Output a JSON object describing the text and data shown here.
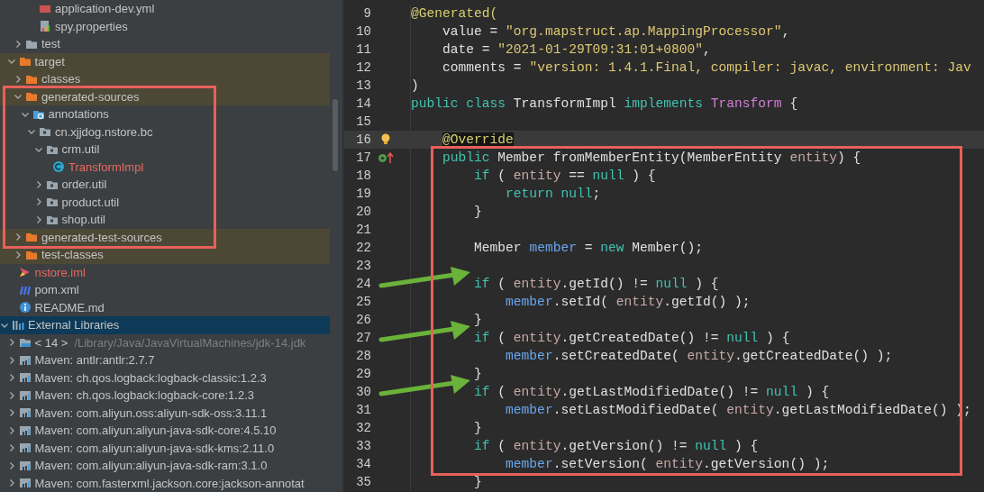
{
  "project_tree": {
    "items": [
      {
        "children": [
          {
            "children": [
              {
                "children": [
                  {
                    "children": [
                      {
                        "label": "application-dev.yml",
                        "kind": "yml-file",
                        "selected": false,
                        "excluded": false,
                        "untracked": false,
                        "in_callout": false
                      },
                      {
                        "label": "spy.properties",
                        "kind": "properties-file",
                        "selected": false,
                        "excluded": false,
                        "untracked": false,
                        "in_callout": false
                      }
                    ]
                  }
                ]
              },
              {
                "label": "test",
                "kind": "folder",
                "expanded": false,
                "selected": false,
                "excluded": false,
                "untracked": false,
                "in_callout": false
              }
            ]
          },
          {
            "label": "target",
            "kind": "folder",
            "expanded": true,
            "selected": false,
            "excluded": true,
            "untracked": false,
            "in_callout": false,
            "children": [
              {
                "label": "classes",
                "kind": "folder",
                "expanded": false,
                "selected": false,
                "excluded": true,
                "untracked": false,
                "in_callout": false
              },
              {
                "label": "generated-sources",
                "kind": "folder",
                "expanded": true,
                "selected": false,
                "excluded": true,
                "untracked": false,
                "in_callout": true,
                "children": [
                  {
                    "label": "annotations",
                    "kind": "source-root",
                    "expanded": true,
                    "selected": false,
                    "excluded": false,
                    "untracked": false,
                    "in_callout": true,
                    "children": [
                      {
                        "label": "cn.xjjdog.nstore.bc",
                        "kind": "package",
                        "expanded": true,
                        "selected": false,
                        "excluded": false,
                        "untracked": false,
                        "in_callout": true,
                        "children": [
                          {
                            "label": "crm.util",
                            "kind": "package",
                            "expanded": true,
                            "selected": false,
                            "excluded": false,
                            "untracked": false,
                            "in_callout": true,
                            "children": [
                              {
                                "label": "TransformImpl",
                                "kind": "class",
                                "selected": false,
                                "excluded": false,
                                "untracked": true,
                                "in_callout": true
                              }
                            ]
                          },
                          {
                            "label": "order.util",
                            "kind": "package",
                            "expanded": false,
                            "selected": false,
                            "excluded": false,
                            "untracked": false,
                            "in_callout": true
                          },
                          {
                            "label": "product.util",
                            "kind": "package",
                            "expanded": false,
                            "selected": false,
                            "excluded": false,
                            "untracked": false,
                            "in_callout": true
                          },
                          {
                            "label": "shop.util",
                            "kind": "package",
                            "expanded": false,
                            "selected": false,
                            "excluded": false,
                            "untracked": false,
                            "in_callout": true
                          }
                        ]
                      }
                    ]
                  }
                ]
              },
              {
                "label": "generated-test-sources",
                "kind": "folder",
                "expanded": false,
                "selected": false,
                "excluded": true,
                "untracked": false,
                "in_callout": true
              },
              {
                "label": "test-classes",
                "kind": "folder",
                "expanded": false,
                "selected": false,
                "excluded": true,
                "untracked": false,
                "in_callout": false
              }
            ]
          },
          {
            "label": "nstore.iml",
            "kind": "module-file",
            "selected": false,
            "excluded": false,
            "untracked": true,
            "in_callout": false
          },
          {
            "label": "pom.xml",
            "kind": "maven-file",
            "selected": false,
            "excluded": false,
            "untracked": false,
            "in_callout": false
          },
          {
            "label": "README.md",
            "kind": "info-file",
            "selected": false,
            "excluded": false,
            "untracked": false,
            "in_callout": false
          }
        ]
      },
      {
        "label": "External Libraries",
        "kind": "libraries",
        "expanded": true,
        "selected": true,
        "excluded": false,
        "untracked": false,
        "in_callout": false,
        "children": [
          {
            "label": "< 14 >",
            "detail": "/Library/Java/JavaVirtualMachines/jdk-14.jdk",
            "kind": "jdk",
            "expanded": false,
            "selected": false,
            "excluded": false,
            "untracked": false,
            "in_callout": false
          },
          {
            "label": "Maven: antlr:antlr:2.7.7",
            "kind": "library",
            "expanded": false,
            "selected": false,
            "excluded": false,
            "untracked": false,
            "in_callout": false
          },
          {
            "label": "Maven: ch.qos.logback:logback-classic:1.2.3",
            "kind": "library",
            "expanded": false,
            "selected": false,
            "excluded": false,
            "untracked": false,
            "in_callout": false
          },
          {
            "label": "Maven: ch.qos.logback:logback-core:1.2.3",
            "kind": "library",
            "expanded": false,
            "selected": false,
            "excluded": false,
            "untracked": false,
            "in_callout": false
          },
          {
            "label": "Maven: com.aliyun.oss:aliyun-sdk-oss:3.11.1",
            "kind": "library",
            "expanded": false,
            "selected": false,
            "excluded": false,
            "untracked": false,
            "in_callout": false
          },
          {
            "label": "Maven: com.aliyun:aliyun-java-sdk-core:4.5.10",
            "kind": "library",
            "expanded": false,
            "selected": false,
            "excluded": false,
            "untracked": false,
            "in_callout": false
          },
          {
            "label": "Maven: com.aliyun:aliyun-java-sdk-kms:2.11.0",
            "kind": "library",
            "expanded": false,
            "selected": false,
            "excluded": false,
            "untracked": false,
            "in_callout": false
          },
          {
            "label": "Maven: com.aliyun:aliyun-java-sdk-ram:3.1.0",
            "kind": "library",
            "expanded": false,
            "selected": false,
            "excluded": false,
            "untracked": false,
            "in_callout": false
          },
          {
            "label": "Maven: com.fasterxml.jackson.core:jackson-annotat",
            "kind": "library",
            "expanded": false,
            "selected": false,
            "excluded": false,
            "untracked": false,
            "in_callout": false
          }
        ]
      }
    ]
  },
  "editor": {
    "lines": [
      {
        "number": "9",
        "current": false,
        "in_callout": false,
        "arrow": false,
        "tokens": [
          {
            "text": "@Generated(",
            "kind": "annotation"
          }
        ]
      },
      {
        "number": "10",
        "current": false,
        "in_callout": false,
        "arrow": false,
        "tokens": [
          {
            "text": "    value = ",
            "kind": "plain"
          },
          {
            "text": "\"org.mapstruct.ap.MappingProcessor\"",
            "kind": "string"
          },
          {
            "text": ",",
            "kind": "plain"
          }
        ]
      },
      {
        "number": "11",
        "current": false,
        "in_callout": false,
        "arrow": false,
        "tokens": [
          {
            "text": "    date = ",
            "kind": "plain"
          },
          {
            "text": "\"2021-01-29T09:31:01+0800\"",
            "kind": "string"
          },
          {
            "text": ",",
            "kind": "plain"
          }
        ]
      },
      {
        "number": "12",
        "current": false,
        "in_callout": false,
        "arrow": false,
        "tokens": [
          {
            "text": "    comments = ",
            "kind": "plain"
          },
          {
            "text": "\"version: 1.4.1.Final, compiler: javac, environment: Jav",
            "kind": "string"
          }
        ]
      },
      {
        "number": "13",
        "current": false,
        "in_callout": false,
        "arrow": false,
        "tokens": [
          {
            "text": ")",
            "kind": "plain"
          }
        ]
      },
      {
        "number": "14",
        "current": false,
        "in_callout": false,
        "arrow": false,
        "tokens": [
          {
            "text": "public class ",
            "kind": "keyword"
          },
          {
            "text": "TransformImpl ",
            "kind": "plain"
          },
          {
            "text": "implements ",
            "kind": "keyword"
          },
          {
            "text": "Transform",
            "kind": "interface"
          },
          {
            "text": " {",
            "kind": "plain"
          }
        ]
      },
      {
        "number": "15",
        "current": false,
        "in_callout": false,
        "arrow": false
      },
      {
        "number": "16",
        "kind": "bulb",
        "current": true,
        "in_callout": false,
        "arrow": false,
        "tokens": [
          {
            "text": "    @Override",
            "kind": "annotation-match"
          }
        ]
      },
      {
        "number": "17",
        "kind": "override",
        "current": false,
        "in_callout": true,
        "arrow": false,
        "tokens": [
          {
            "text": "    public ",
            "kind": "keyword"
          },
          {
            "text": "Member fromMemberEntity(MemberEntity ",
            "kind": "plain"
          },
          {
            "text": "entity",
            "kind": "parameter"
          },
          {
            "text": ") {",
            "kind": "plain"
          }
        ]
      },
      {
        "number": "18",
        "current": false,
        "in_callout": true,
        "arrow": false,
        "tokens": [
          {
            "text": "        if ",
            "kind": "keyword"
          },
          {
            "text": "( ",
            "kind": "plain"
          },
          {
            "text": "entity",
            "kind": "parameter"
          },
          {
            "text": " == ",
            "kind": "plain"
          },
          {
            "text": "null",
            "kind": "keyword"
          },
          {
            "text": " ) {",
            "kind": "plain"
          }
        ]
      },
      {
        "number": "19",
        "current": false,
        "in_callout": true,
        "arrow": false,
        "tokens": [
          {
            "text": "            return null",
            "kind": "keyword"
          },
          {
            "text": ";",
            "kind": "plain"
          }
        ]
      },
      {
        "number": "20",
        "current": false,
        "in_callout": true,
        "arrow": false,
        "tokens": [
          {
            "text": "        }",
            "kind": "plain"
          }
        ]
      },
      {
        "number": "21",
        "current": false,
        "in_callout": true,
        "arrow": false
      },
      {
        "number": "22",
        "current": false,
        "in_callout": true,
        "arrow": false,
        "tokens": [
          {
            "text": "        Member ",
            "kind": "plain"
          },
          {
            "text": "member",
            "kind": "local"
          },
          {
            "text": " = ",
            "kind": "plain"
          },
          {
            "text": "new ",
            "kind": "keyword"
          },
          {
            "text": "Member();",
            "kind": "plain"
          }
        ]
      },
      {
        "number": "23",
        "current": false,
        "in_callout": true,
        "arrow": false
      },
      {
        "number": "24",
        "current": false,
        "in_callout": true,
        "arrow": true,
        "tokens": [
          {
            "text": "        if ",
            "kind": "keyword"
          },
          {
            "text": "( ",
            "kind": "plain"
          },
          {
            "text": "entity",
            "kind": "parameter"
          },
          {
            "text": ".getId() != ",
            "kind": "plain"
          },
          {
            "text": "null",
            "kind": "keyword"
          },
          {
            "text": " ) {",
            "kind": "plain"
          }
        ]
      },
      {
        "number": "25",
        "current": false,
        "in_callout": true,
        "arrow": false,
        "tokens": [
          {
            "text": "            member",
            "kind": "local"
          },
          {
            "text": ".setId( ",
            "kind": "plain"
          },
          {
            "text": "entity",
            "kind": "parameter"
          },
          {
            "text": ".getId() );",
            "kind": "plain"
          }
        ]
      },
      {
        "number": "26",
        "current": false,
        "in_callout": true,
        "arrow": false,
        "tokens": [
          {
            "text": "        }",
            "kind": "plain"
          }
        ]
      },
      {
        "number": "27",
        "current": false,
        "in_callout": true,
        "arrow": true,
        "tokens": [
          {
            "text": "        if ",
            "kind": "keyword"
          },
          {
            "text": "( ",
            "kind": "plain"
          },
          {
            "text": "entity",
            "kind": "parameter"
          },
          {
            "text": ".getCreatedDate() != ",
            "kind": "plain"
          },
          {
            "text": "null",
            "kind": "keyword"
          },
          {
            "text": " ) {",
            "kind": "plain"
          }
        ]
      },
      {
        "number": "28",
        "current": false,
        "in_callout": true,
        "arrow": false,
        "tokens": [
          {
            "text": "            member",
            "kind": "local"
          },
          {
            "text": ".setCreatedDate( ",
            "kind": "plain"
          },
          {
            "text": "entity",
            "kind": "parameter"
          },
          {
            "text": ".getCreatedDate() );",
            "kind": "plain"
          }
        ]
      },
      {
        "number": "29",
        "current": false,
        "in_callout": true,
        "arrow": false,
        "tokens": [
          {
            "text": "        }",
            "kind": "plain"
          }
        ]
      },
      {
        "number": "30",
        "current": false,
        "in_callout": true,
        "arrow": true,
        "tokens": [
          {
            "text": "        if ",
            "kind": "keyword"
          },
          {
            "text": "( ",
            "kind": "plain"
          },
          {
            "text": "entity",
            "kind": "parameter"
          },
          {
            "text": ".getLastModifiedDate() != ",
            "kind": "plain"
          },
          {
            "text": "null",
            "kind": "keyword"
          },
          {
            "text": " ) {",
            "kind": "plain"
          }
        ]
      },
      {
        "number": "31",
        "current": false,
        "in_callout": true,
        "arrow": false,
        "tokens": [
          {
            "text": "            member",
            "kind": "local"
          },
          {
            "text": ".setLastModifiedDate( ",
            "kind": "plain"
          },
          {
            "text": "entity",
            "kind": "parameter"
          },
          {
            "text": ".getLastModifiedDate() );",
            "kind": "plain"
          }
        ]
      },
      {
        "number": "32",
        "current": false,
        "in_callout": true,
        "arrow": false,
        "tokens": [
          {
            "text": "        }",
            "kind": "plain"
          }
        ]
      },
      {
        "number": "33",
        "current": false,
        "in_callout": true,
        "arrow": false,
        "tokens": [
          {
            "text": "        if ",
            "kind": "keyword"
          },
          {
            "text": "( ",
            "kind": "plain"
          },
          {
            "text": "entity",
            "kind": "parameter"
          },
          {
            "text": ".getVersion() != ",
            "kind": "plain"
          },
          {
            "text": "null",
            "kind": "keyword"
          },
          {
            "text": " ) {",
            "kind": "plain"
          }
        ]
      },
      {
        "number": "34",
        "current": false,
        "in_callout": true,
        "arrow": false,
        "tokens": [
          {
            "text": "            member",
            "kind": "local"
          },
          {
            "text": ".setVersion( ",
            "kind": "plain"
          },
          {
            "text": "entity",
            "kind": "parameter"
          },
          {
            "text": ".getVersion() );",
            "kind": "plain"
          }
        ]
      },
      {
        "number": "35",
        "current": false,
        "in_callout": false,
        "arrow": false,
        "tokens": [
          {
            "text": "        }",
            "kind": "plain"
          }
        ]
      }
    ]
  }
}
